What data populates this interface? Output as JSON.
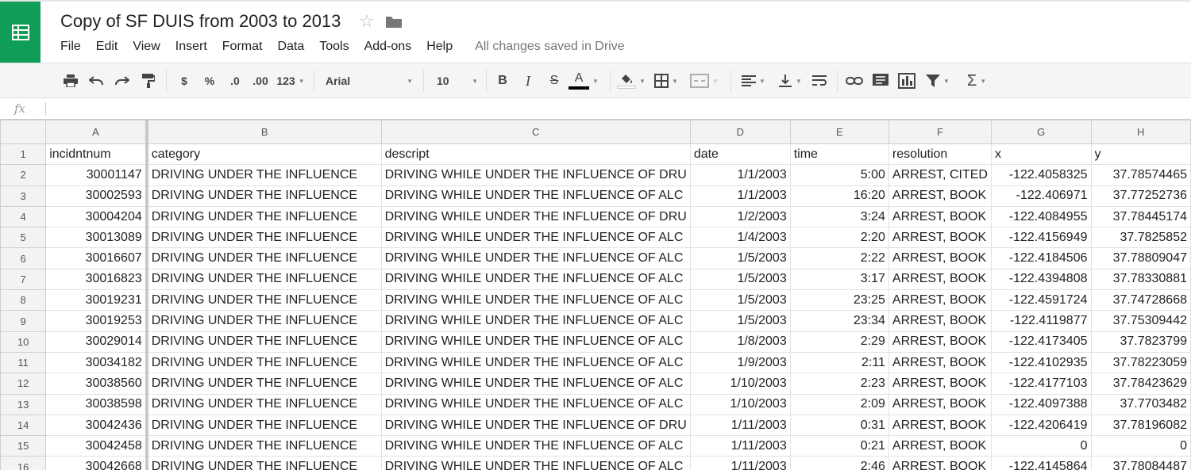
{
  "header": {
    "title": "Copy of SF DUIS from 2003 to 2013",
    "save_status": "All changes saved in Drive",
    "menus": [
      "File",
      "Edit",
      "View",
      "Insert",
      "Format",
      "Data",
      "Tools",
      "Add-ons",
      "Help"
    ]
  },
  "toolbar": {
    "currency": "$",
    "percent": "%",
    "decrease_decimal": ".0",
    "increase_decimal": ".00",
    "more_formats": "123",
    "font": "Arial",
    "font_size": "10",
    "bold": "B",
    "italic": "I",
    "strike": "S",
    "text_color": "A",
    "functions": "Σ"
  },
  "formula_bar": {
    "fx": "fx"
  },
  "colors": {
    "brand": "#0f9d58",
    "header_bg": "#f3f3f3",
    "grid_line": "#e2e2e2"
  },
  "grid": {
    "columns": [
      "A",
      "B",
      "C",
      "D",
      "E",
      "F",
      "G",
      "H"
    ],
    "header_row": [
      "incidntnum",
      "category",
      "descript",
      "date",
      "time",
      "resolution",
      "x",
      "y"
    ],
    "rows": [
      {
        "n": "2",
        "cells": [
          "30001147",
          "DRIVING UNDER THE INFLUENCE",
          "DRIVING WHILE UNDER THE INFLUENCE OF DRU",
          "1/1/2003",
          "5:00",
          "ARREST, CITED",
          "-122.4058325",
          "37.78574465"
        ]
      },
      {
        "n": "3",
        "cells": [
          "30002593",
          "DRIVING UNDER THE INFLUENCE",
          "DRIVING WHILE UNDER THE INFLUENCE OF ALC",
          "1/1/2003",
          "16:20",
          "ARREST, BOOK",
          "-122.406971",
          "37.77252736"
        ]
      },
      {
        "n": "4",
        "cells": [
          "30004204",
          "DRIVING UNDER THE INFLUENCE",
          "DRIVING WHILE UNDER THE INFLUENCE OF DRU",
          "1/2/2003",
          "3:24",
          "ARREST, BOOK",
          "-122.4084955",
          "37.78445174"
        ]
      },
      {
        "n": "5",
        "cells": [
          "30013089",
          "DRIVING UNDER THE INFLUENCE",
          "DRIVING WHILE UNDER THE INFLUENCE OF ALC",
          "1/4/2003",
          "2:20",
          "ARREST, BOOK",
          "-122.4156949",
          "37.7825852"
        ]
      },
      {
        "n": "6",
        "cells": [
          "30016607",
          "DRIVING UNDER THE INFLUENCE",
          "DRIVING WHILE UNDER THE INFLUENCE OF ALC",
          "1/5/2003",
          "2:22",
          "ARREST, BOOK",
          "-122.4184506",
          "37.78809047"
        ]
      },
      {
        "n": "7",
        "cells": [
          "30016823",
          "DRIVING UNDER THE INFLUENCE",
          "DRIVING WHILE UNDER THE INFLUENCE OF ALC",
          "1/5/2003",
          "3:17",
          "ARREST, BOOK",
          "-122.4394808",
          "37.78330881"
        ]
      },
      {
        "n": "8",
        "cells": [
          "30019231",
          "DRIVING UNDER THE INFLUENCE",
          "DRIVING WHILE UNDER THE INFLUENCE OF ALC",
          "1/5/2003",
          "23:25",
          "ARREST, BOOK",
          "-122.4591724",
          "37.74728668"
        ]
      },
      {
        "n": "9",
        "cells": [
          "30019253",
          "DRIVING UNDER THE INFLUENCE",
          "DRIVING WHILE UNDER THE INFLUENCE OF ALC",
          "1/5/2003",
          "23:34",
          "ARREST, BOOK",
          "-122.4119877",
          "37.75309442"
        ]
      },
      {
        "n": "10",
        "cells": [
          "30029014",
          "DRIVING UNDER THE INFLUENCE",
          "DRIVING WHILE UNDER THE INFLUENCE OF ALC",
          "1/8/2003",
          "2:29",
          "ARREST, BOOK",
          "-122.4173405",
          "37.7823799"
        ]
      },
      {
        "n": "11",
        "cells": [
          "30034182",
          "DRIVING UNDER THE INFLUENCE",
          "DRIVING WHILE UNDER THE INFLUENCE OF ALC",
          "1/9/2003",
          "2:11",
          "ARREST, BOOK",
          "-122.4102935",
          "37.78223059"
        ]
      },
      {
        "n": "12",
        "cells": [
          "30038560",
          "DRIVING UNDER THE INFLUENCE",
          "DRIVING WHILE UNDER THE INFLUENCE OF ALC",
          "1/10/2003",
          "2:23",
          "ARREST, BOOK",
          "-122.4177103",
          "37.78423629"
        ]
      },
      {
        "n": "13",
        "cells": [
          "30038598",
          "DRIVING UNDER THE INFLUENCE",
          "DRIVING WHILE UNDER THE INFLUENCE OF ALC",
          "1/10/2003",
          "2:09",
          "ARREST, BOOK",
          "-122.4097388",
          "37.7703482"
        ]
      },
      {
        "n": "14",
        "cells": [
          "30042436",
          "DRIVING UNDER THE INFLUENCE",
          "DRIVING WHILE UNDER THE INFLUENCE OF DRU",
          "1/11/2003",
          "0:31",
          "ARREST, BOOK",
          "-122.4206419",
          "37.78196082"
        ]
      },
      {
        "n": "15",
        "cells": [
          "30042458",
          "DRIVING UNDER THE INFLUENCE",
          "DRIVING WHILE UNDER THE INFLUENCE OF ALC",
          "1/11/2003",
          "0:21",
          "ARREST, BOOK",
          "0",
          "0"
        ]
      },
      {
        "n": "16",
        "cells": [
          "30042668",
          "DRIVING UNDER THE INFLUENCE",
          "DRIVING WHILE UNDER THE INFLUENCE OF ALC",
          "1/11/2003",
          "2:46",
          "ARREST, BOOK",
          "-122.4145864",
          "37.78084487"
        ]
      }
    ]
  }
}
